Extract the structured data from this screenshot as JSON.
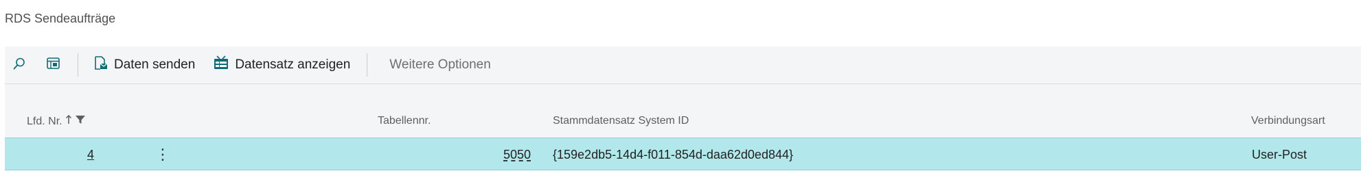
{
  "page": {
    "title": "RDS Sendeaufträge"
  },
  "actions": {
    "search_icon": "search-icon",
    "layout_icon": "layout-icon",
    "send_label": "Daten senden",
    "show_record_label": "Datensatz anzeigen",
    "more_options_label": "Weitere Optionen"
  },
  "table": {
    "columns": {
      "lfd_nr": "Lfd. Nr.",
      "tabellennr": "Tabellennr.",
      "system_id": "Stammdatensatz System ID",
      "verbindungsart": "Verbindungsart"
    },
    "rows": [
      {
        "lfd_nr": "4",
        "menu": "⋮",
        "tabellennr": "5050",
        "system_id": "{159e2db5-14d4-f011-854d-daa62d0ed844}",
        "verbindungsart": "User-Post"
      }
    ]
  },
  "colors": {
    "accent": "#0f6b75",
    "row_selected": "#b2e8ec",
    "bar_bg": "#f4f5f7"
  }
}
